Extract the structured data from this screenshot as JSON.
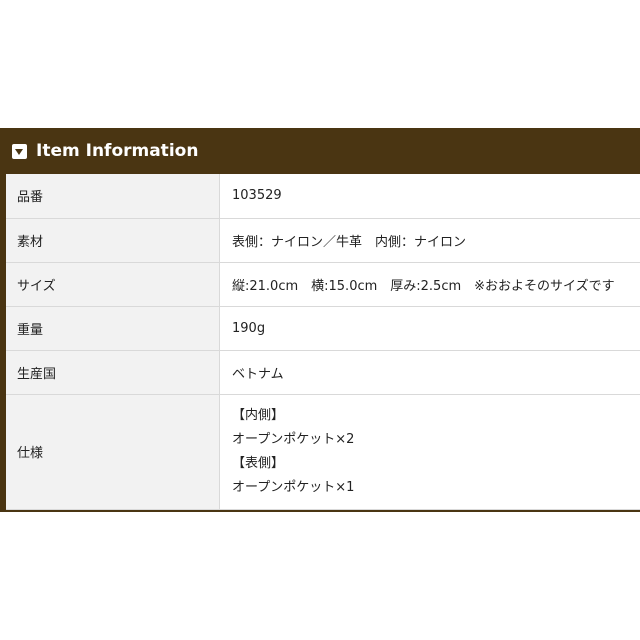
{
  "header": {
    "title": "Item Information",
    "icon": "triangle-down-icon"
  },
  "rows": [
    {
      "label": "品番",
      "value": "103529"
    },
    {
      "label": "素材",
      "value": "表側：ナイロン／牛革　内側：ナイロン"
    },
    {
      "label": "サイズ",
      "value": "縦:21.0cm　横:15.0cm　厚み:2.5cm　※おおよそのサイズです"
    },
    {
      "label": "重量",
      "value": "190g"
    },
    {
      "label": "生産国",
      "value": "ベトナム"
    },
    {
      "label": "仕様",
      "lines": [
        "【内側】",
        "オープンポケット×2",
        "【表側】",
        "オープンポケット×1"
      ]
    }
  ]
}
